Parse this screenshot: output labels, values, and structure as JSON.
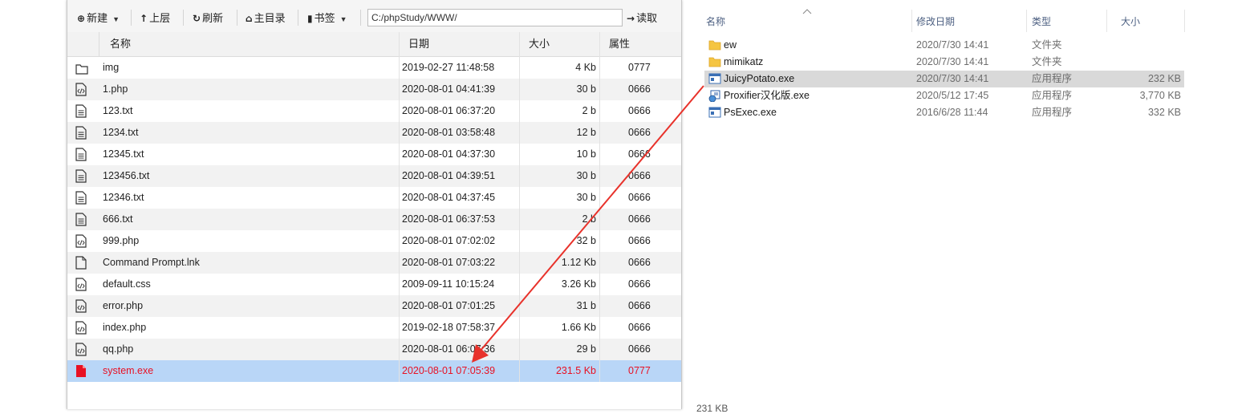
{
  "file_manager": {
    "toolbar": {
      "new_label": "新建",
      "up_label": "上层",
      "refresh_label": "刷新",
      "home_label": "主目录",
      "bookmark_label": "书签",
      "path_value": "C:/phpStudy/WWW/",
      "read_label": "读取"
    },
    "columns": {
      "name": "名称",
      "date": "日期",
      "size": "大小",
      "perm": "属性"
    },
    "rows": [
      {
        "icon": "folder-icon",
        "name": "img",
        "date": "2019-02-27 11:48:58",
        "size": "4 Kb",
        "perm": "0777"
      },
      {
        "icon": "code-file-icon",
        "name": "1.php",
        "date": "2020-08-01 04:41:39",
        "size": "30 b",
        "perm": "0666"
      },
      {
        "icon": "text-file-icon",
        "name": "123.txt",
        "date": "2020-08-01 06:37:20",
        "size": "2 b",
        "perm": "0666"
      },
      {
        "icon": "text-file-icon",
        "name": "1234.txt",
        "date": "2020-08-01 03:58:48",
        "size": "12 b",
        "perm": "0666"
      },
      {
        "icon": "text-file-icon",
        "name": "12345.txt",
        "date": "2020-08-01 04:37:30",
        "size": "10 b",
        "perm": "0666"
      },
      {
        "icon": "text-file-icon",
        "name": "123456.txt",
        "date": "2020-08-01 04:39:51",
        "size": "30 b",
        "perm": "0666"
      },
      {
        "icon": "text-file-icon",
        "name": "12346.txt",
        "date": "2020-08-01 04:37:45",
        "size": "30 b",
        "perm": "0666"
      },
      {
        "icon": "text-file-icon",
        "name": "666.txt",
        "date": "2020-08-01 06:37:53",
        "size": "2 b",
        "perm": "0666"
      },
      {
        "icon": "code-file-icon",
        "name": "999.php",
        "date": "2020-08-01 07:02:02",
        "size": "32 b",
        "perm": "0666"
      },
      {
        "icon": "blank-file-icon",
        "name": "Command Prompt.lnk",
        "date": "2020-08-01 07:03:22",
        "size": "1.12 Kb",
        "perm": "0666"
      },
      {
        "icon": "code-file-icon",
        "name": "default.css",
        "date": "2009-09-11 10:15:24",
        "size": "3.26 Kb",
        "perm": "0666"
      },
      {
        "icon": "code-file-icon",
        "name": "error.php",
        "date": "2020-08-01 07:01:25",
        "size": "31 b",
        "perm": "0666"
      },
      {
        "icon": "code-file-icon",
        "name": "index.php",
        "date": "2019-02-18 07:58:37",
        "size": "1.66 Kb",
        "perm": "0666"
      },
      {
        "icon": "code-file-icon",
        "name": "qq.php",
        "date": "2020-08-01 06:07:36",
        "size": "29 b",
        "perm": "0666"
      },
      {
        "icon": "red-file-icon",
        "name": "system.exe",
        "date": "2020-08-01 07:05:39",
        "size": "231.5 Kb",
        "perm": "0777"
      }
    ],
    "selected_color": "#e81123",
    "selected_bg": "#b9d6f7"
  },
  "explorer": {
    "columns": {
      "name": "名称",
      "date": "修改日期",
      "type": "类型",
      "size": "大小"
    },
    "rows": [
      {
        "icon": "folder-icon",
        "name": "ew",
        "date": "2020/7/30 14:41",
        "type": "文件夹",
        "size": ""
      },
      {
        "icon": "folder-icon",
        "name": "mimikatz",
        "date": "2020/7/30 14:41",
        "type": "文件夹",
        "size": ""
      },
      {
        "icon": "exe-icon",
        "name": "JuicyPotato.exe",
        "date": "2020/7/30 14:41",
        "type": "应用程序",
        "size": "232 KB"
      },
      {
        "icon": "proxifier-icon",
        "name": "Proxifier汉化版.exe",
        "date": "2020/5/12 17:45",
        "type": "应用程序",
        "size": "3,770 KB"
      },
      {
        "icon": "exe-icon",
        "name": "PsExec.exe",
        "date": "2016/6/28 11:44",
        "type": "应用程序",
        "size": "332 KB"
      }
    ],
    "status_fragment": "231 KB"
  },
  "annotation": {
    "arrow_color": "#e8322b"
  }
}
